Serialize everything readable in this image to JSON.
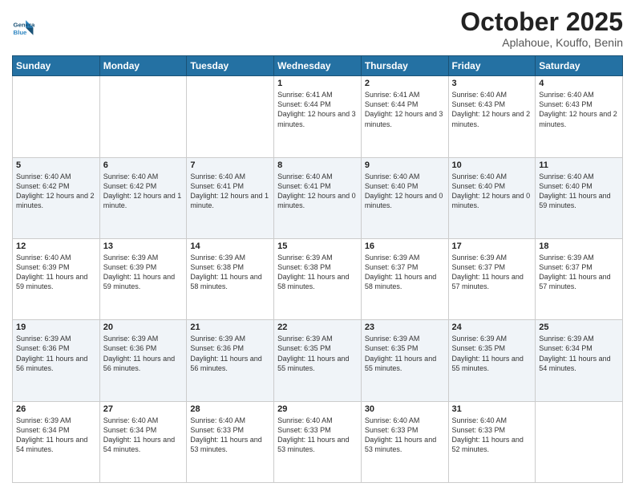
{
  "header": {
    "logo_line1": "General",
    "logo_line2": "Blue",
    "month": "October 2025",
    "location": "Aplahoue, Kouffo, Benin"
  },
  "weekdays": [
    "Sunday",
    "Monday",
    "Tuesday",
    "Wednesday",
    "Thursday",
    "Friday",
    "Saturday"
  ],
  "weeks": [
    [
      {
        "day": "",
        "info": ""
      },
      {
        "day": "",
        "info": ""
      },
      {
        "day": "",
        "info": ""
      },
      {
        "day": "1",
        "info": "Sunrise: 6:41 AM\nSunset: 6:44 PM\nDaylight: 12 hours\nand 3 minutes."
      },
      {
        "day": "2",
        "info": "Sunrise: 6:41 AM\nSunset: 6:44 PM\nDaylight: 12 hours\nand 3 minutes."
      },
      {
        "day": "3",
        "info": "Sunrise: 6:40 AM\nSunset: 6:43 PM\nDaylight: 12 hours\nand 2 minutes."
      },
      {
        "day": "4",
        "info": "Sunrise: 6:40 AM\nSunset: 6:43 PM\nDaylight: 12 hours\nand 2 minutes."
      }
    ],
    [
      {
        "day": "5",
        "info": "Sunrise: 6:40 AM\nSunset: 6:42 PM\nDaylight: 12 hours\nand 2 minutes."
      },
      {
        "day": "6",
        "info": "Sunrise: 6:40 AM\nSunset: 6:42 PM\nDaylight: 12 hours\nand 1 minute."
      },
      {
        "day": "7",
        "info": "Sunrise: 6:40 AM\nSunset: 6:41 PM\nDaylight: 12 hours\nand 1 minute."
      },
      {
        "day": "8",
        "info": "Sunrise: 6:40 AM\nSunset: 6:41 PM\nDaylight: 12 hours\nand 0 minutes."
      },
      {
        "day": "9",
        "info": "Sunrise: 6:40 AM\nSunset: 6:40 PM\nDaylight: 12 hours\nand 0 minutes."
      },
      {
        "day": "10",
        "info": "Sunrise: 6:40 AM\nSunset: 6:40 PM\nDaylight: 12 hours\nand 0 minutes."
      },
      {
        "day": "11",
        "info": "Sunrise: 6:40 AM\nSunset: 6:40 PM\nDaylight: 11 hours\nand 59 minutes."
      }
    ],
    [
      {
        "day": "12",
        "info": "Sunrise: 6:40 AM\nSunset: 6:39 PM\nDaylight: 11 hours\nand 59 minutes."
      },
      {
        "day": "13",
        "info": "Sunrise: 6:39 AM\nSunset: 6:39 PM\nDaylight: 11 hours\nand 59 minutes."
      },
      {
        "day": "14",
        "info": "Sunrise: 6:39 AM\nSunset: 6:38 PM\nDaylight: 11 hours\nand 58 minutes."
      },
      {
        "day": "15",
        "info": "Sunrise: 6:39 AM\nSunset: 6:38 PM\nDaylight: 11 hours\nand 58 minutes."
      },
      {
        "day": "16",
        "info": "Sunrise: 6:39 AM\nSunset: 6:37 PM\nDaylight: 11 hours\nand 58 minutes."
      },
      {
        "day": "17",
        "info": "Sunrise: 6:39 AM\nSunset: 6:37 PM\nDaylight: 11 hours\nand 57 minutes."
      },
      {
        "day": "18",
        "info": "Sunrise: 6:39 AM\nSunset: 6:37 PM\nDaylight: 11 hours\nand 57 minutes."
      }
    ],
    [
      {
        "day": "19",
        "info": "Sunrise: 6:39 AM\nSunset: 6:36 PM\nDaylight: 11 hours\nand 56 minutes."
      },
      {
        "day": "20",
        "info": "Sunrise: 6:39 AM\nSunset: 6:36 PM\nDaylight: 11 hours\nand 56 minutes."
      },
      {
        "day": "21",
        "info": "Sunrise: 6:39 AM\nSunset: 6:36 PM\nDaylight: 11 hours\nand 56 minutes."
      },
      {
        "day": "22",
        "info": "Sunrise: 6:39 AM\nSunset: 6:35 PM\nDaylight: 11 hours\nand 55 minutes."
      },
      {
        "day": "23",
        "info": "Sunrise: 6:39 AM\nSunset: 6:35 PM\nDaylight: 11 hours\nand 55 minutes."
      },
      {
        "day": "24",
        "info": "Sunrise: 6:39 AM\nSunset: 6:35 PM\nDaylight: 11 hours\nand 55 minutes."
      },
      {
        "day": "25",
        "info": "Sunrise: 6:39 AM\nSunset: 6:34 PM\nDaylight: 11 hours\nand 54 minutes."
      }
    ],
    [
      {
        "day": "26",
        "info": "Sunrise: 6:39 AM\nSunset: 6:34 PM\nDaylight: 11 hours\nand 54 minutes."
      },
      {
        "day": "27",
        "info": "Sunrise: 6:40 AM\nSunset: 6:34 PM\nDaylight: 11 hours\nand 54 minutes."
      },
      {
        "day": "28",
        "info": "Sunrise: 6:40 AM\nSunset: 6:33 PM\nDaylight: 11 hours\nand 53 minutes."
      },
      {
        "day": "29",
        "info": "Sunrise: 6:40 AM\nSunset: 6:33 PM\nDaylight: 11 hours\nand 53 minutes."
      },
      {
        "day": "30",
        "info": "Sunrise: 6:40 AM\nSunset: 6:33 PM\nDaylight: 11 hours\nand 53 minutes."
      },
      {
        "day": "31",
        "info": "Sunrise: 6:40 AM\nSunset: 6:33 PM\nDaylight: 11 hours\nand 52 minutes."
      },
      {
        "day": "",
        "info": ""
      }
    ]
  ]
}
